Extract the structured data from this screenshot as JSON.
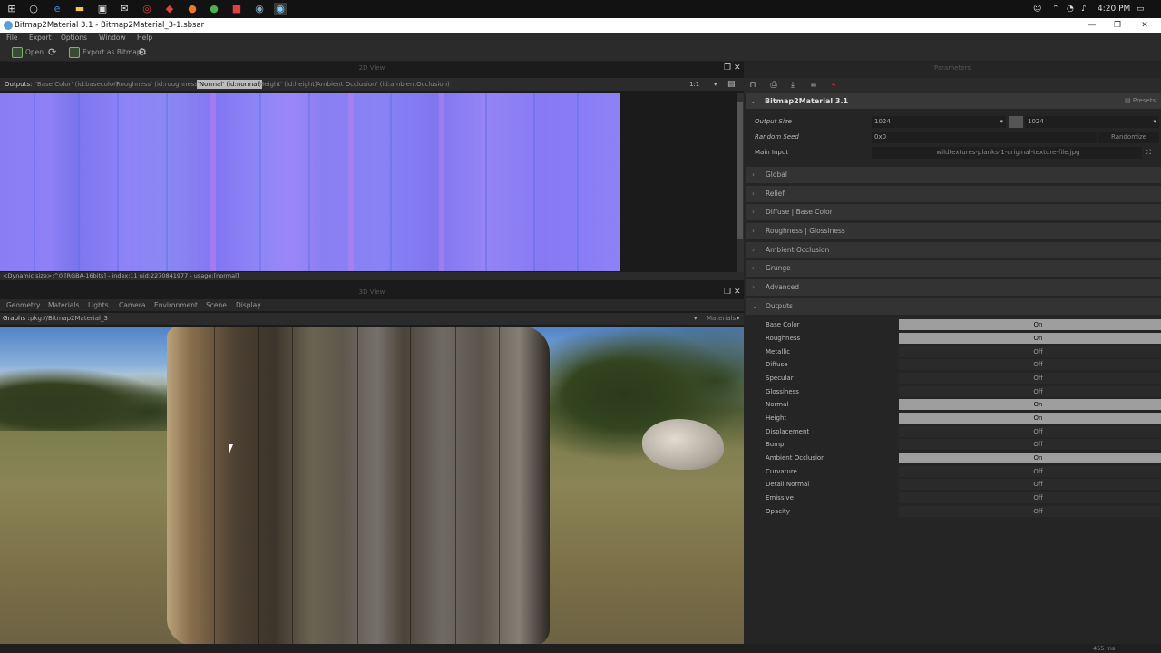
{
  "taskbar": {
    "time": "4:20 PM"
  },
  "window": {
    "title": "Bitmap2Material 3.1 - Bitmap2Material_3-1.sbsar"
  },
  "menu": [
    "File",
    "Export",
    "Options",
    "Window",
    "Help"
  ],
  "toolbar": {
    "open": "Open",
    "export": "Export as Bitmap"
  },
  "view2d": {
    "header": "2D View",
    "outputs_label": "Outputs:",
    "tabs": [
      "'Base Color' (id:basecolor)",
      "'Roughness' (id:roughness)",
      "'Normal' (id:normal)",
      "'Height' (id:height)",
      "'Ambient Occlusion' (id:ambientOcclusion)"
    ],
    "selected": 2,
    "zoom": "1:1",
    "status": "<Dynamic size>:^0 [RGBA-16bits] - index:11 uid:2270841977 - usage:[normal]"
  },
  "view3d": {
    "header": "3D View",
    "menu": [
      "Geometry",
      "Materials",
      "Lights",
      "Camera",
      "Environment",
      "Scene",
      "Display"
    ],
    "graphs_label": "Graphs :",
    "graph_path": "pkg://Bitmap2Material_3",
    "materials_label": "Materials"
  },
  "parameters": {
    "header": "Parameters",
    "title": "Bitmap2Material 3.1",
    "presets": "Presets",
    "output_size_label": "Output Size",
    "output_size_w": "1024",
    "output_size_h": "1024",
    "random_seed_label": "Random Seed",
    "random_seed": "0x0",
    "randomize": "Randomize",
    "main_input_label": "Main Input",
    "main_input_file": "wildtextures-planks-1-original-texture-file.jpg",
    "sections": [
      "Global",
      "Relief",
      "Diffuse | Base Color",
      "Roughness | Glossiness",
      "Ambient Occlusion",
      "Grunge",
      "Advanced",
      "Outputs"
    ],
    "outputs": [
      {
        "name": "Base Color",
        "state": "On"
      },
      {
        "name": "Roughness",
        "state": "On"
      },
      {
        "name": "Metallic",
        "state": "Off"
      },
      {
        "name": "Diffuse",
        "state": "Off"
      },
      {
        "name": "Specular",
        "state": "Off"
      },
      {
        "name": "Glossiness",
        "state": "Off"
      },
      {
        "name": "Normal",
        "state": "On"
      },
      {
        "name": "Height",
        "state": "On"
      },
      {
        "name": "Displacement",
        "state": "Off"
      },
      {
        "name": "Bump",
        "state": "Off"
      },
      {
        "name": "Ambient Occlusion",
        "state": "On"
      },
      {
        "name": "Curvature",
        "state": "Off"
      },
      {
        "name": "Detail Normal",
        "state": "Off"
      },
      {
        "name": "Emissive",
        "state": "Off"
      },
      {
        "name": "Opacity",
        "state": "Off"
      }
    ]
  },
  "status": {
    "render_time": "455 ms"
  }
}
